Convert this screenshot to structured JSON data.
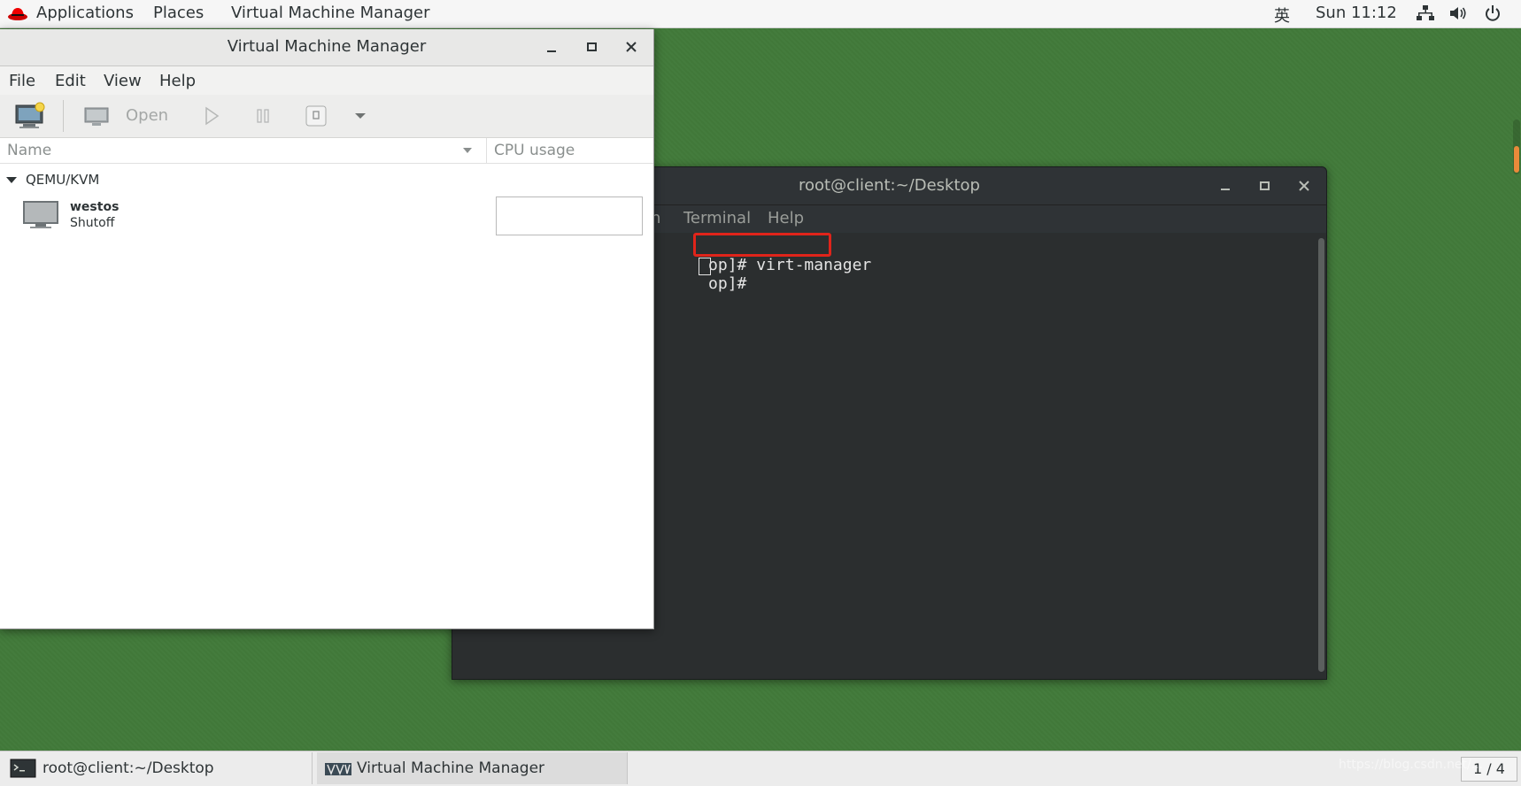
{
  "topbar": {
    "applications": "Applications",
    "places": "Places",
    "active_app": "Virtual Machine Manager",
    "input_method": "英",
    "clock": "Sun 11:12"
  },
  "terminal": {
    "title": "root@client:~/Desktop",
    "menu": [
      "h",
      "Terminal",
      "Help"
    ],
    "line1_prefix": "op]# ",
    "line1_command": "virt-manager",
    "line2_prefix": "op]# "
  },
  "vmm": {
    "title": "Virtual Machine Manager",
    "menu": [
      "File",
      "Edit",
      "View",
      "Help"
    ],
    "toolbar": {
      "open_label": "Open"
    },
    "columns": {
      "name": "Name",
      "cpu": "CPU usage"
    },
    "group": "QEMU/KVM",
    "vms": [
      {
        "name": "westos",
        "status": "Shutoff"
      }
    ]
  },
  "taskbar": {
    "tasks": [
      {
        "label": "root@client:~/Desktop"
      },
      {
        "label": "Virtual Machine Manager"
      }
    ],
    "workspace": "1 / 4"
  },
  "watermark": "https://blog.csdn.net/..."
}
